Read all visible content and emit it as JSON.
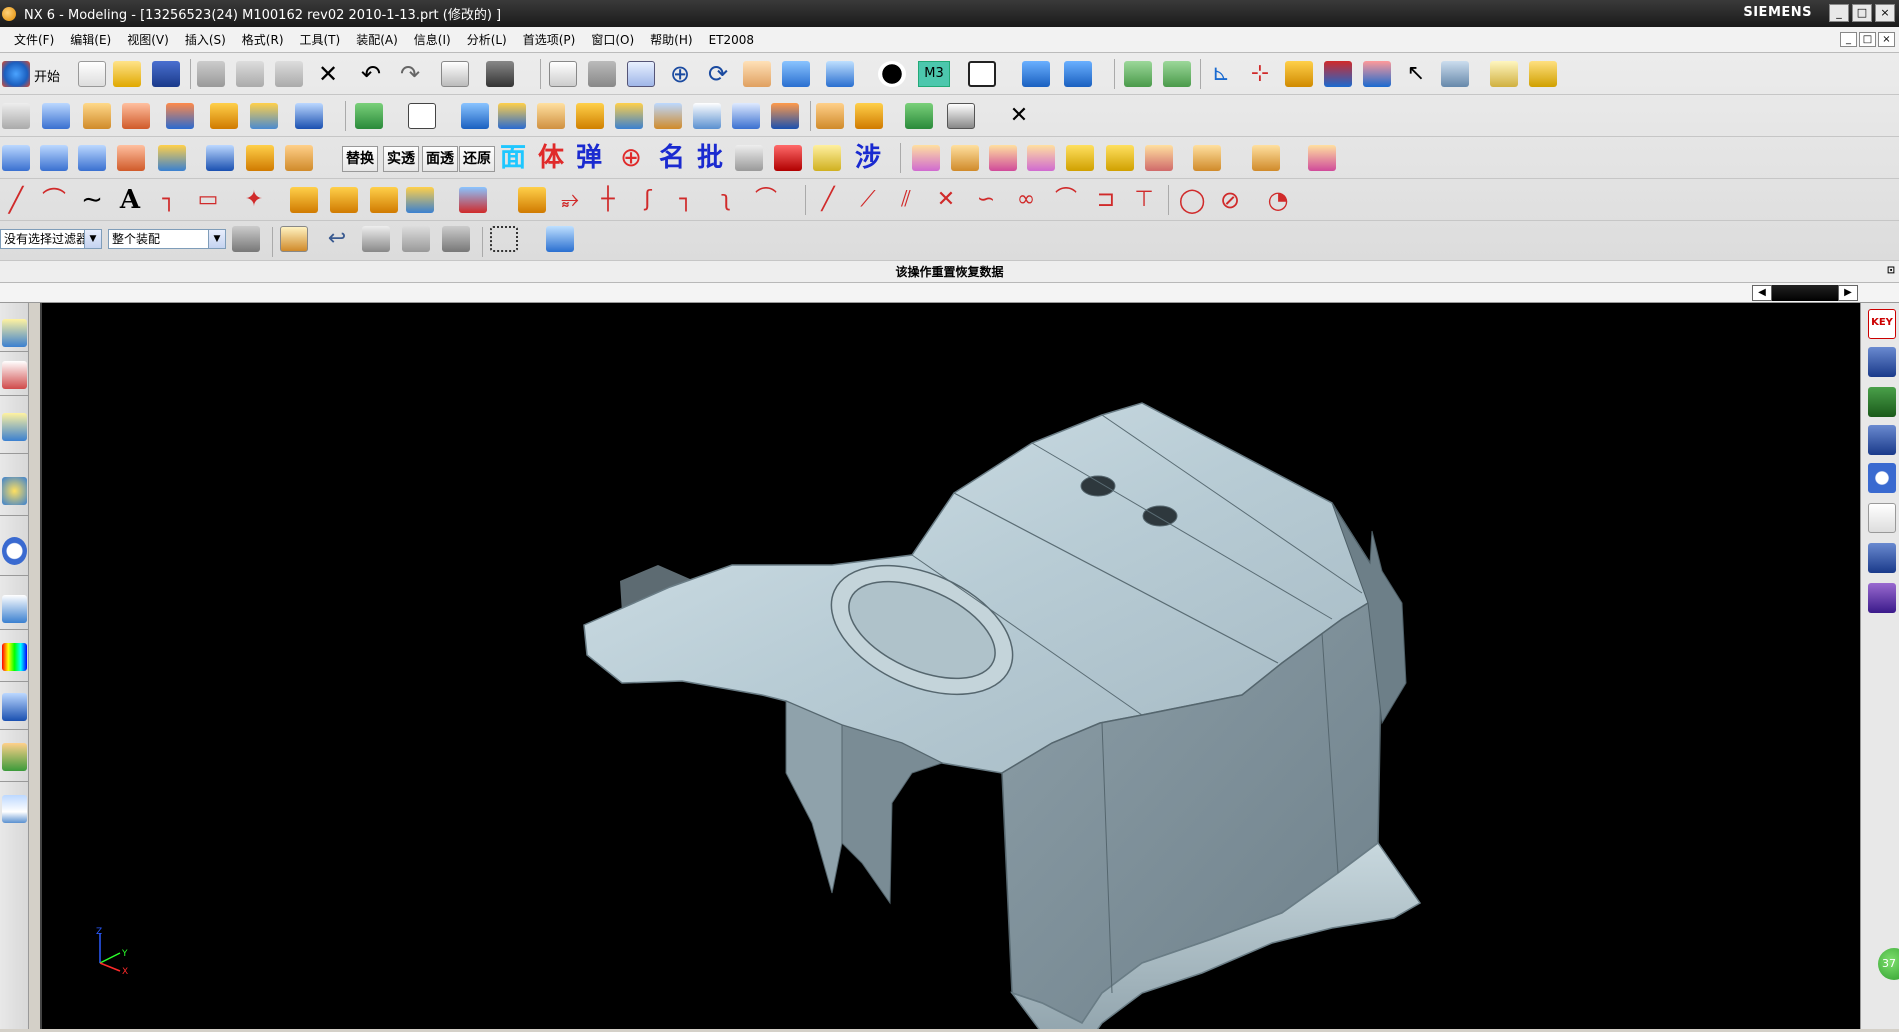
{
  "window": {
    "title": "NX 6 - Modeling - [13256523(24) M100162  rev02 2010-1-13.prt  (修改的) ]",
    "brand": "SIEMENS",
    "controls": [
      "_",
      "□",
      "×"
    ]
  },
  "menubar": {
    "items": [
      "文件(F)",
      "编辑(E)",
      "视图(V)",
      "插入(S)",
      "格式(R)",
      "工具(T)",
      "装配(A)",
      "信息(I)",
      "分析(L)",
      "首选项(P)",
      "窗口(O)",
      "帮助(H)",
      "ET2008"
    ]
  },
  "toolbar": {
    "start_label": "开始",
    "m3_label": "M3",
    "text_buttons": [
      "替换",
      "实透",
      "面透",
      "还原"
    ],
    "big_chars": [
      "面",
      "体",
      "弹",
      "名",
      "批",
      "涉"
    ],
    "filter_combo": "没有选择过滤器",
    "assembly_combo": "整个装配"
  },
  "cue_line": {
    "text": "该操作重置恢复数据"
  },
  "viewport": {
    "axis_labels": [
      "Z",
      "Y",
      "X"
    ]
  },
  "side_badge": "37",
  "right_panel": {
    "key_label": "KEY"
  },
  "colors": {
    "title_bg": "#1a1a1a",
    "viewport_bg": "#000000",
    "part_surface": "#b9cdd6",
    "part_shadow": "#7b8d96"
  }
}
